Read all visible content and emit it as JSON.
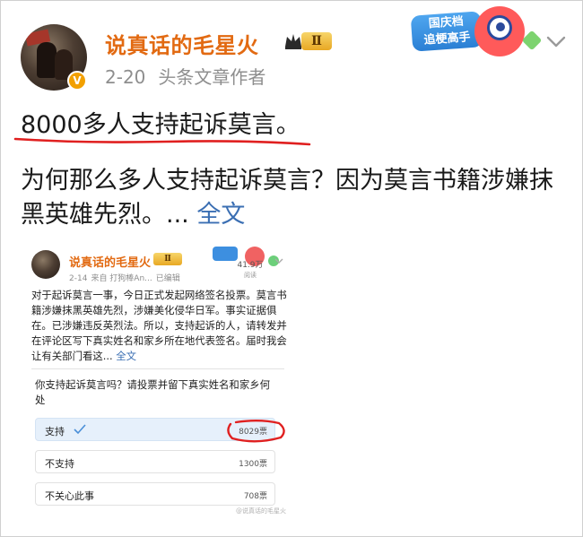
{
  "post": {
    "author": "说真话的毛星火",
    "level_badge": "Ⅱ",
    "verified_mark": "V",
    "date": "2-20",
    "role": "头条文章作者",
    "sticker_text_1": "国庆档",
    "sticker_text_2": "追梗高手",
    "headline": "8000多人支持起诉莫言。",
    "body": "为何那么多人支持起诉莫言？因为莫言书籍涉嫌抹黑英雄先烈。... ",
    "full_text_link": "全文"
  },
  "embedded": {
    "author": "说真话的毛星火",
    "level_badge": "Ⅱ",
    "date": "2-14",
    "source": "来自 打狗棒An...",
    "edited": "已编辑",
    "views": "41.9万",
    "views_label": "阅读",
    "body": "对于起诉莫言一事，今日正式发起网络签名投票。莫言书籍涉嫌抹黑英雄先烈，涉嫌美化侵华日军。事实证据俱在。已涉嫌违反英烈法。所以，支持起诉的人，请转发并在评论区写下真实姓名和家乡所在地代表签名。届时我会让有关部门看这... ",
    "full_text_link": "全文",
    "poll": {
      "question": "你支持起诉莫言吗？请投票并留下真实姓名和家乡何处",
      "options": [
        {
          "label": "支持",
          "count": "8029票",
          "selected": true
        },
        {
          "label": "不支持",
          "count": "1300票",
          "selected": false
        },
        {
          "label": "不关心此事",
          "count": "708票",
          "selected": false
        }
      ]
    },
    "watermark": "@说真话的毛星火"
  },
  "colors": {
    "author": "#e26a12",
    "link": "#3b6fb3",
    "annotation_red": "#e02020"
  }
}
